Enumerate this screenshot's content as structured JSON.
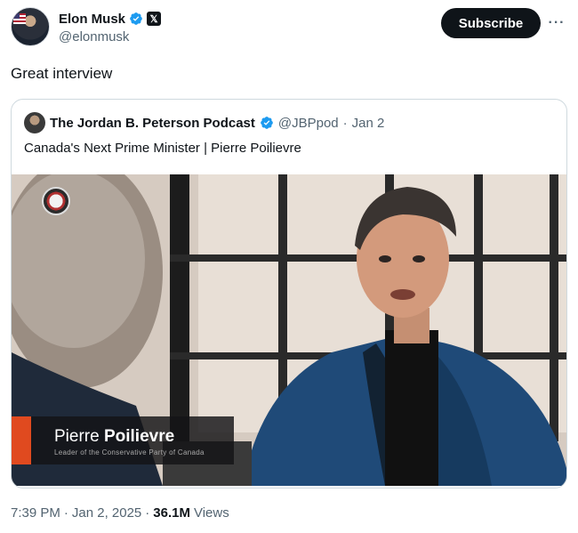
{
  "author": {
    "display_name": "Elon Musk",
    "handle": "@elonmusk",
    "badge_icon": "verified-icon",
    "affiliation_icon": "x-logo-icon"
  },
  "actions": {
    "subscribe_label": "Subscribe",
    "more_label": "···"
  },
  "tweet": {
    "text": "Great interview"
  },
  "quoted": {
    "display_name": "The Jordan B. Peterson Podcast",
    "handle": "@JBPpod",
    "separator": "·",
    "date": "Jan 2",
    "text": "Canada's Next Prime Minister | Pierre Poilievre",
    "video": {
      "caption_first": "Pierre ",
      "caption_last": "Poilievre",
      "caption_sub": "Leader of the Conservative Party of Canada"
    }
  },
  "meta": {
    "time": "7:39 PM",
    "sep1": "·",
    "date": "Jan 2, 2025",
    "sep2": "·",
    "views_count": "36.1M",
    "views_label": "Views"
  },
  "colors": {
    "verified_blue": "#1d9bf0",
    "text_primary": "#0f1419",
    "text_secondary": "#536471",
    "border": "#cfd9de",
    "accent_orange": "#e04a1f"
  }
}
